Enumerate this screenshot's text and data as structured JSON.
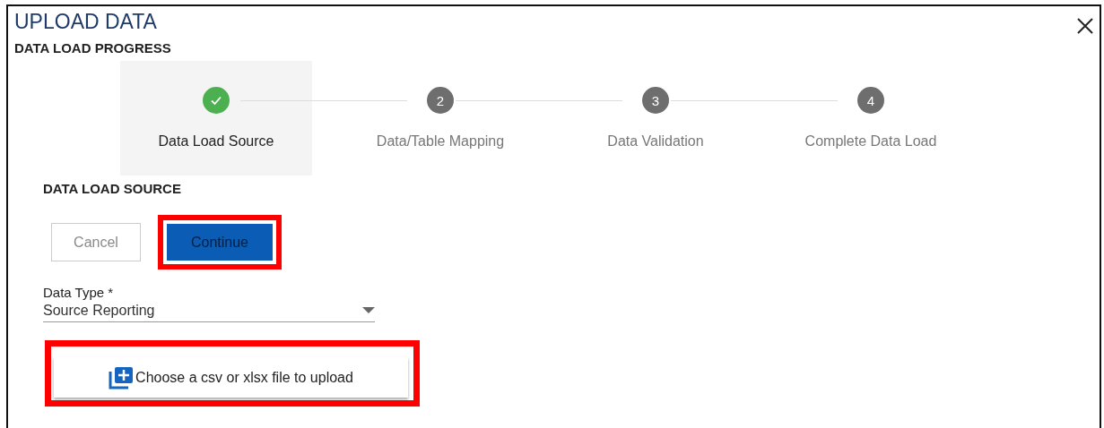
{
  "dialog": {
    "title": "UPLOAD DATA",
    "subtitle": "DATA LOAD PROGRESS"
  },
  "steps": [
    {
      "label": "Data Load Source",
      "done": true,
      "selected": true
    },
    {
      "number": "2",
      "label": "Data/Table Mapping",
      "done": false,
      "selected": false
    },
    {
      "number": "3",
      "label": "Data Validation",
      "done": false,
      "selected": false
    },
    {
      "number": "4",
      "label": "Complete Data Load",
      "done": false,
      "selected": false
    }
  ],
  "section": {
    "title": "DATA LOAD SOURCE"
  },
  "buttons": [
    {
      "kind": "secondary",
      "label": "Cancel",
      "disabled": true,
      "highlighted": false
    },
    {
      "kind": "primary",
      "label": "Continue",
      "disabled": true,
      "highlighted": true
    }
  ],
  "data_type": {
    "label": "Data Type *",
    "value": "Source Reporting"
  },
  "upload": {
    "label": "Choose a csv or xlsx file to upload",
    "highlighted": true
  }
}
